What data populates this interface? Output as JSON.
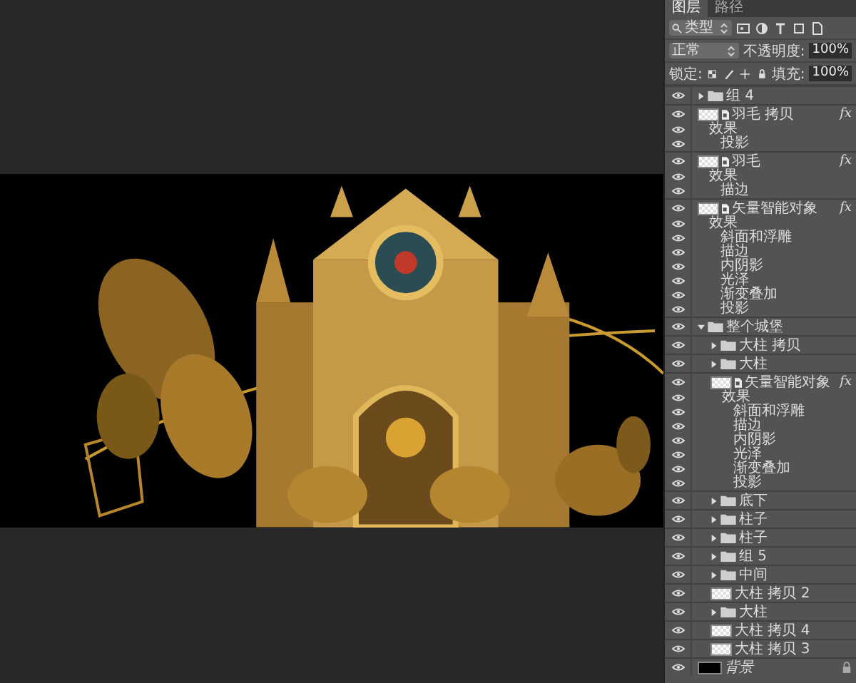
{
  "panel": {
    "tabs": [
      {
        "label": "图层",
        "selected": true
      },
      {
        "label": "路径",
        "selected": false
      }
    ],
    "filter": {
      "label": "类型"
    },
    "blend_mode": "正常",
    "opacity": {
      "label": "不透明度:",
      "value": "100%"
    },
    "lock": {
      "label": "锁定:"
    },
    "fill": {
      "label": "填充:",
      "value": "100%"
    },
    "layers": [
      {
        "name": "组 4",
        "kind": "group",
        "visible": true,
        "expanded": false
      },
      {
        "name": "羽毛 拷贝",
        "kind": "smart_object",
        "visible": true,
        "badge": "fx",
        "effects": {
          "label": "效果",
          "visible": true,
          "items": [
            {
              "name": "投影",
              "visible": true
            }
          ]
        }
      },
      {
        "name": "羽毛",
        "kind": "smart_object",
        "visible": true,
        "badge": "fx",
        "effects": {
          "label": "效果",
          "visible": true,
          "items": [
            {
              "name": "描边",
              "visible": true
            }
          ]
        }
      },
      {
        "name": "矢量智能对象",
        "kind": "smart_object",
        "visible": true,
        "badge": "fx",
        "effects": {
          "label": "效果",
          "visible": true,
          "items": [
            {
              "name": "斜面和浮雕",
              "visible": true
            },
            {
              "name": "描边",
              "visible": true
            },
            {
              "name": "内阴影",
              "visible": true
            },
            {
              "name": "光泽",
              "visible": true
            },
            {
              "name": "渐变叠加",
              "visible": true
            },
            {
              "name": "投影",
              "visible": true
            }
          ]
        }
      },
      {
        "name": "整个城堡",
        "kind": "group",
        "visible": true,
        "expanded": true,
        "children": [
          {
            "name": "大柱 拷贝",
            "kind": "group",
            "visible": true,
            "expanded": false
          },
          {
            "name": "大柱",
            "kind": "group",
            "visible": true,
            "expanded": false
          },
          {
            "name": "矢量智能对象",
            "kind": "smart_object",
            "visible": true,
            "badge": "fx",
            "effects": {
              "label": "效果",
              "visible": true,
              "items": [
                {
                  "name": "斜面和浮雕",
                  "visible": true
                },
                {
                  "name": "描边",
                  "visible": true
                },
                {
                  "name": "内阴影",
                  "visible": true
                },
                {
                  "name": "光泽",
                  "visible": true
                },
                {
                  "name": "渐变叠加",
                  "visible": true
                },
                {
                  "name": "投影",
                  "visible": true
                }
              ]
            }
          },
          {
            "name": "底下",
            "kind": "group",
            "visible": true,
            "expanded": false
          },
          {
            "name": "柱子",
            "kind": "group",
            "visible": true,
            "expanded": false
          },
          {
            "name": "柱子",
            "kind": "group",
            "visible": true,
            "expanded": false
          },
          {
            "name": "组 5",
            "kind": "group",
            "visible": true,
            "expanded": false
          },
          {
            "name": "中间",
            "kind": "group",
            "visible": true,
            "expanded": false
          },
          {
            "name": "大柱 拷贝 2",
            "kind": "layer",
            "visible": true
          },
          {
            "name": "大柱",
            "kind": "group",
            "visible": true,
            "expanded": false
          },
          {
            "name": "大柱 拷贝 4",
            "kind": "layer",
            "visible": true
          },
          {
            "name": "大柱 拷贝 3",
            "kind": "layer",
            "visible": true
          }
        ]
      },
      {
        "name": "背景",
        "kind": "background",
        "visible": true,
        "locked": true
      }
    ]
  }
}
